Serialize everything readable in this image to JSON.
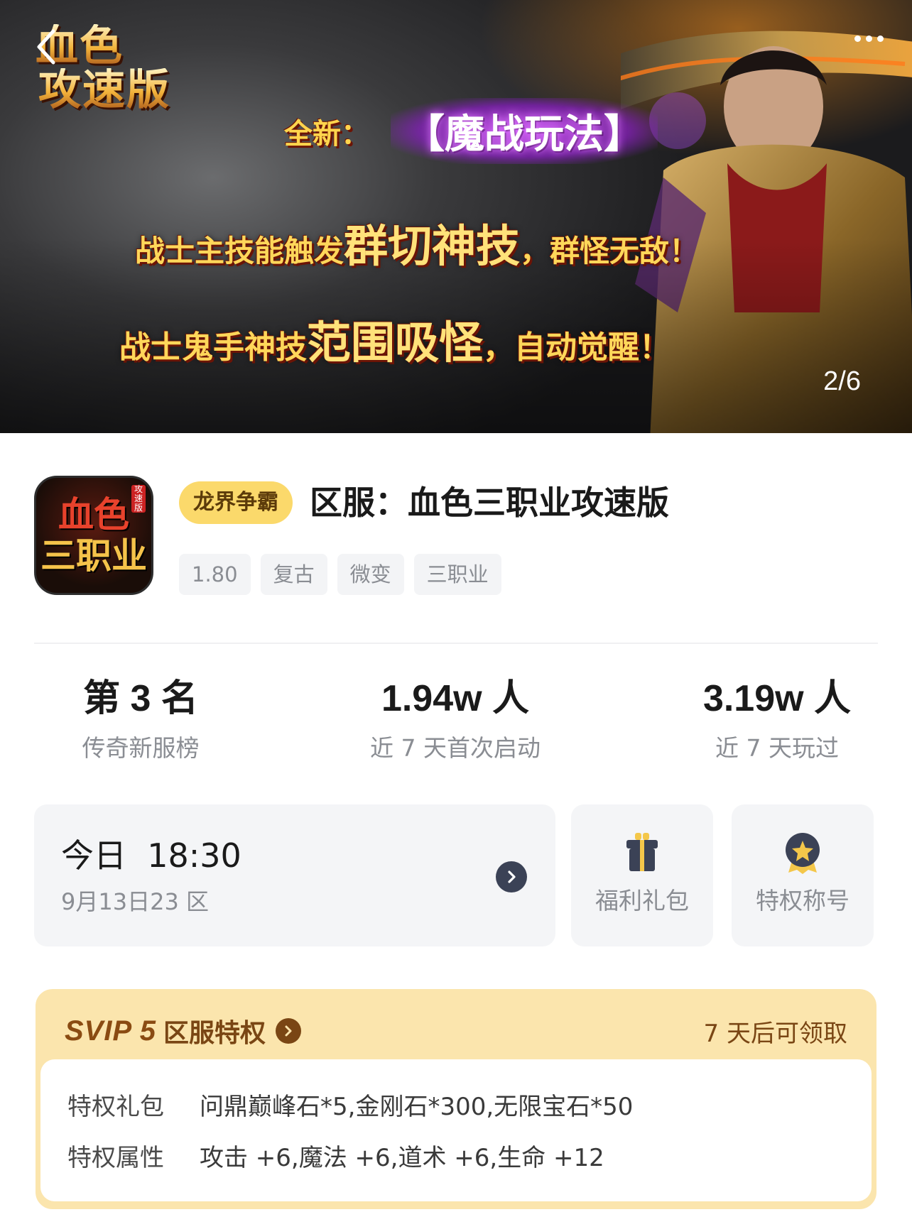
{
  "banner": {
    "logo_line1": "血色",
    "logo_line2": "攻速版",
    "headline_prefix": "全新：",
    "headline_main": "【魔战玩法】",
    "promo1_a": "战士主技能触发",
    "promo1_b": "群切神技",
    "promo1_c": "，群怪无敌！",
    "promo2_a": "战士鬼手神技",
    "promo2_b": "范围吸怪",
    "promo2_c": "，自动觉醒！",
    "pager": "2/6"
  },
  "game": {
    "icon_line1": "血色",
    "icon_line2": "三职业",
    "icon_tag": "攻速版",
    "badge": "龙界争霸",
    "title": "区服：血色三职业攻速版",
    "tags": [
      "1.80",
      "复古",
      "微变",
      "三职业"
    ]
  },
  "stats": [
    {
      "value": "第 3 名",
      "label": "传奇新服榜"
    },
    {
      "value": "1.94w 人",
      "label": "近 7 天首次启动"
    },
    {
      "value": "3.19w 人",
      "label": "近 7 天玩过"
    }
  ],
  "server": {
    "time": "今日  18:30",
    "name": "9月13日23 区"
  },
  "quick_actions": {
    "gift_label": "福利礼包",
    "title_label": "特权称号"
  },
  "svip": {
    "logo": "SVIP 5",
    "title": "区服特权",
    "status": "7 天后可领取",
    "rows": [
      {
        "key": "特权礼包",
        "value": "问鼎巅峰石*5,金刚石*300,无限宝石*50"
      },
      {
        "key": "特权属性",
        "value": "攻击 +6,魔法 +6,道术 +6,生命 +12"
      }
    ]
  },
  "colors": {
    "badge_bg": "#fbd96b",
    "svip_bg": "#fbe5ad",
    "svip_text": "#7a4614",
    "card_bg": "#f4f5f7",
    "muted_text": "#8a8d93"
  }
}
